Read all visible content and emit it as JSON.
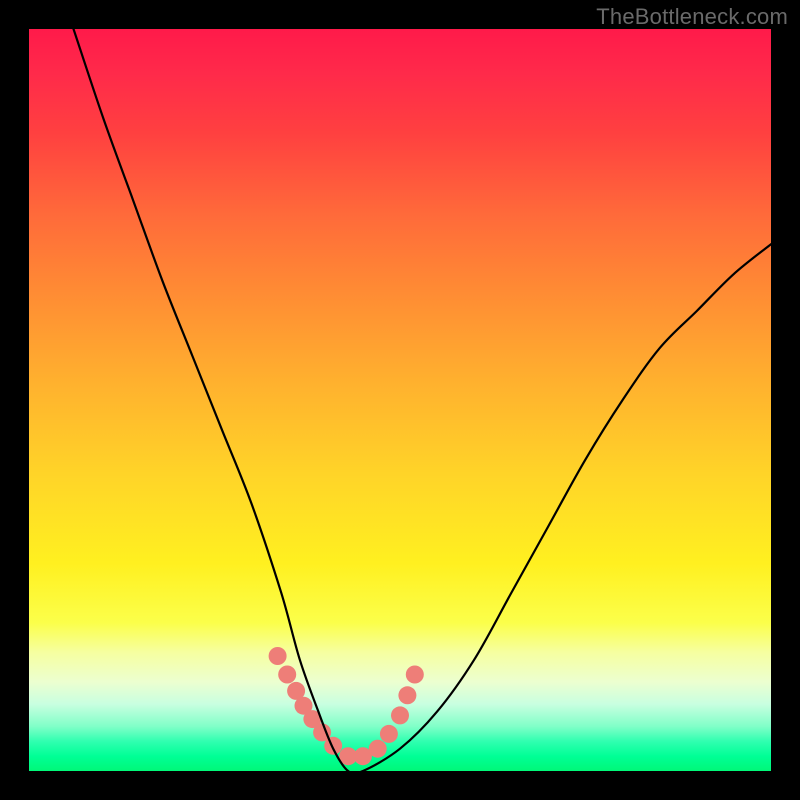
{
  "watermark": "TheBottleneck.com",
  "colors": {
    "curve": "#000000",
    "marker": "#ee7e78",
    "background_frame": "#000000"
  },
  "chart_data": {
    "type": "line",
    "title": "",
    "xlabel": "",
    "ylabel": "",
    "xlim": [
      0,
      100
    ],
    "ylim": [
      0,
      100
    ],
    "grid": false,
    "legend": false,
    "note": "No axis ticks or labels are shown; values below are visual-proportion estimates of the plotted curve (x,y in percent of plot width/height, origin at bottom-left).",
    "series": [
      {
        "name": "curve",
        "x": [
          6,
          10,
          14,
          18,
          22,
          26,
          30,
          34,
          36.5,
          39,
          41,
          43,
          45,
          50,
          55,
          60,
          65,
          70,
          75,
          80,
          85,
          90,
          95,
          100
        ],
        "y": [
          100,
          88,
          77,
          66,
          56,
          46,
          36,
          24,
          15,
          8,
          3,
          0,
          0,
          3,
          8,
          15,
          24,
          33,
          42,
          50,
          57,
          62,
          67,
          71
        ]
      }
    ],
    "markers": {
      "name": "highlight-dots",
      "x": [
        33.5,
        34.8,
        36.0,
        37.0,
        38.2,
        39.5,
        41.0,
        43.0,
        45.0,
        47.0,
        48.5,
        50.0,
        51.0,
        52.0
      ],
      "y": [
        15.5,
        13.0,
        10.8,
        8.8,
        7.0,
        5.2,
        3.4,
        2.0,
        2.0,
        3.0,
        5.0,
        7.5,
        10.2,
        13.0
      ]
    }
  }
}
